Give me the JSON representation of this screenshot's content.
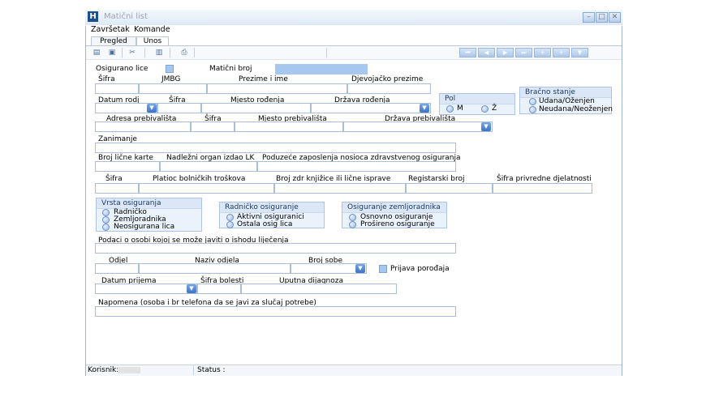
{
  "window": {
    "title": "Matični list",
    "app_icon": "H"
  },
  "menu": [
    "Završetak",
    "Komande"
  ],
  "tabs": [
    "Pregled",
    "Unos"
  ],
  "nav_buttons": [
    "⏮",
    "◀",
    "▶",
    "⏭",
    "+",
    "+",
    "▼"
  ],
  "form": {
    "osigurano_lice": "Osigurano lice",
    "maticni_broj": "Matični broj",
    "row1": {
      "sifra": "Šifra",
      "jmbg": "JMBG",
      "prezime_ime": "Prezime i ime",
      "djevojacko": "Djevojačko prezime"
    },
    "row2": {
      "datum_rodj": "Datum rodj",
      "sifra": "Šifra",
      "mjesto_rodjenja": "Mjesto rođenja",
      "drzava_rodjenja": "Država rođenja"
    },
    "pol": {
      "title": "Pol",
      "m": "M",
      "z": "Ž"
    },
    "bracno_stanje": {
      "title": "Bračno stanje",
      "opt1": "Udana/Oženjen",
      "opt2": "Neudana/Neoženjen"
    },
    "row3": {
      "adresa": "Adresa prebivališta",
      "sifra": "Šifra",
      "mjesto": "Mjesto prebivališta",
      "drzava": "Država prebivališta"
    },
    "zanimanje": "Zanimanje",
    "row5": {
      "broj_lk": "Broj lične karte",
      "nadlezni": "Nadležni organ izdao LK",
      "poduzece": "Poduzeće zaposlenja nosioca zdravstvenog osiguranja"
    },
    "row6": {
      "sifra": "Šifra",
      "platioc": "Platioc bolničkih troškova",
      "broj_zdr": "Broj zdr knjižice ili lične isprave",
      "registarski": "Registarski broj",
      "sifra_djel": "Šifra privredne djelatnosti"
    },
    "vrsta": {
      "title": "Vrsta osiguranja",
      "opt1": "Radničko",
      "opt2": "Zemljoradnika",
      "opt3": "Neosigurana lica"
    },
    "radnicko": {
      "title": "Radničko osiguranje",
      "opt1": "Aktivni osiguranici",
      "opt2": "Ostala osig lica"
    },
    "zemlj": {
      "title": "Osiguranje zemljoradnika",
      "opt1": "Osnovno osiguranje",
      "opt2": "Prošireno osiguranje"
    },
    "podaci": "Podaci o osobi kojoj se može javiti o ishodu liječenja",
    "row8": {
      "odjel": "Odjel",
      "naziv_odjela": "Naziv odjela",
      "broj_sobe": "Broj sobe",
      "prijava": "Prijava porođaja"
    },
    "row9": {
      "datum_prijema": "Datum prijema",
      "sifra_bolesti": "Šifra bolesti",
      "uputna": "Uputna dijagnoza"
    },
    "napomena": "Napomena (osoba i br telefona da se javi za slučaj potrebe)"
  },
  "status": {
    "korisnik": "Korisnik:",
    "status": "Status :"
  },
  "icons": [
    "new-icon",
    "save-icon",
    "cut-icon",
    "delete-icon",
    "print-icon",
    "chevron-down-icon",
    "radio-icon"
  ],
  "colors": {
    "accent": "#a6c8ee",
    "group_bg": "#eaf2fc",
    "border": "#a9bed8"
  }
}
